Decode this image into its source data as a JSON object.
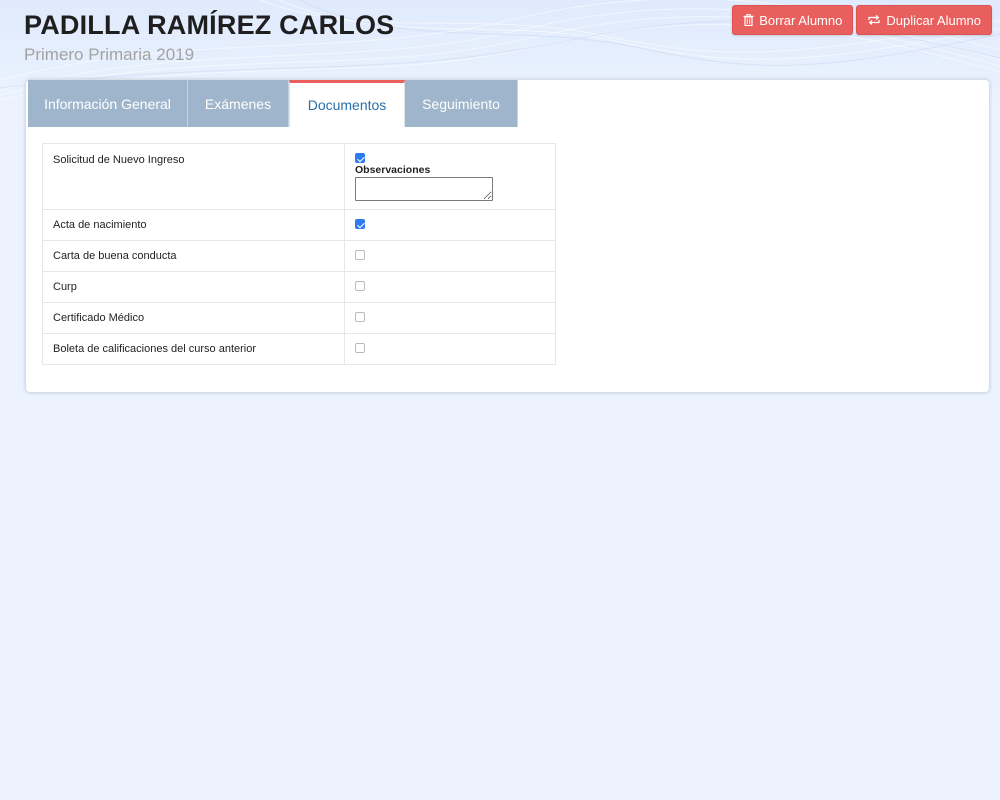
{
  "student": {
    "name": "PADILLA RAMÍREZ CARLOS",
    "grade": "Primero Primaria 2019"
  },
  "actions": {
    "delete_label": "Borrar Alumno",
    "duplicate_label": "Duplicar Alumno",
    "delete_icon": "trash-icon",
    "duplicate_icon": "repeat-icon"
  },
  "tabs": [
    {
      "label": "Información General",
      "active": false
    },
    {
      "label": "Exámenes",
      "active": false
    },
    {
      "label": "Documentos",
      "active": true
    },
    {
      "label": "Seguimiento",
      "active": false
    }
  ],
  "documents": {
    "observations_label": "Observaciones",
    "observations_value": "",
    "rows": [
      {
        "label": "Solicitud de Nuevo Ingreso",
        "checked": true
      },
      {
        "label": "Acta de nacimiento",
        "checked": true
      },
      {
        "label": "Carta de buena conducta",
        "checked": false
      },
      {
        "label": "Curp",
        "checked": false
      },
      {
        "label": "Certificado Médico",
        "checked": false
      },
      {
        "label": "Boleta de calificaciones del curso anterior",
        "checked": false
      }
    ]
  },
  "colors": {
    "accent_red": "#e95f5d",
    "tab_inactive": "#9fb5cb",
    "tab_active_text": "#2a6fa8",
    "checkbox_on": "#2f7bf0",
    "page_bg": "#ecf3fe"
  }
}
